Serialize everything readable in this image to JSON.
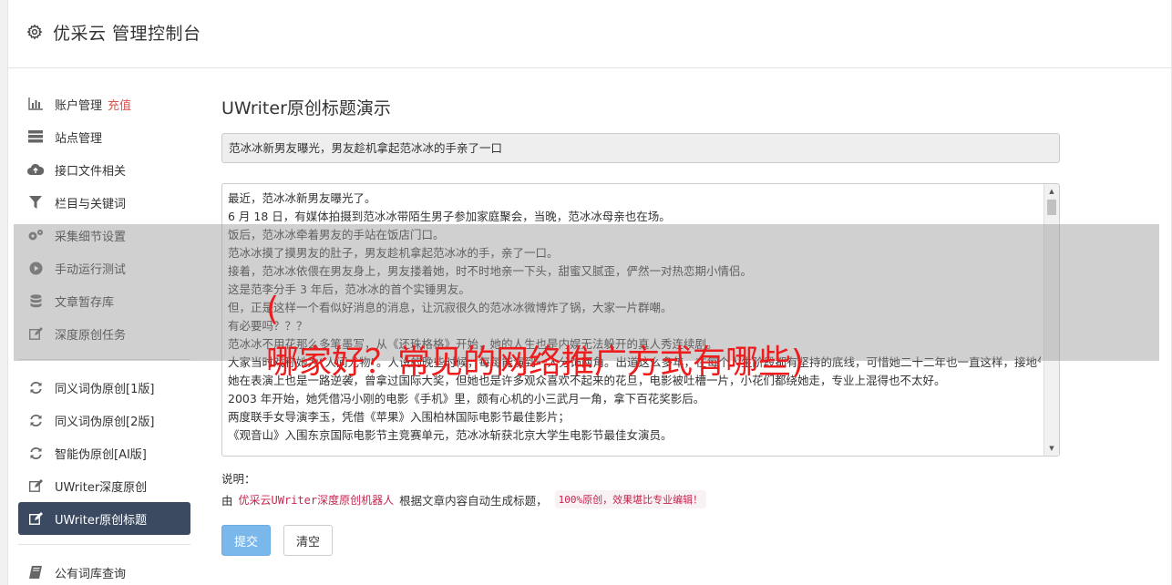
{
  "header": {
    "title": "优采云 管理控制台",
    "icon": "gear-icon"
  },
  "sidebar": {
    "items": [
      {
        "label": "账户管理",
        "badge": "充值",
        "icon": "bar-chart-icon"
      },
      {
        "label": "站点管理",
        "icon": "server-icon"
      },
      {
        "label": "接口文件相关",
        "icon": "cloud-upload-icon"
      },
      {
        "label": "栏目与关键词",
        "icon": "filter-icon"
      },
      {
        "label": "采集细节设置",
        "icon": "cogs-icon"
      },
      {
        "label": "手动运行测试",
        "icon": "play-circle-icon"
      },
      {
        "label": "文章暂存库",
        "icon": "database-icon"
      },
      {
        "label": "深度原创任务",
        "icon": "edit-icon"
      }
    ],
    "items2": [
      {
        "label": "同义词伪原创[1版]",
        "icon": "refresh-icon"
      },
      {
        "label": "同义词伪原创[2版]",
        "icon": "refresh-icon"
      },
      {
        "label": "智能伪原创[AI版]",
        "icon": "refresh-icon"
      },
      {
        "label": "UWriter深度原创",
        "icon": "edit-icon"
      },
      {
        "label": "UWriter原创标题",
        "icon": "edit-icon",
        "active": true
      }
    ],
    "items3": [
      {
        "label": "公有词库查询",
        "icon": "book-icon"
      }
    ]
  },
  "main": {
    "heading": "UWriter原创标题演示",
    "title_value": "范冰冰新男友曝光，男友趁机拿起范冰冰的手亲了一口",
    "article_lines": [
      "最近，范冰冰新男友曝光了。",
      "6 月 18 日，有媒体拍摄到范冰冰带陌生男子参加家庭聚会，当晚，范冰冰母亲也在场。",
      "饭后，范冰冰牵着男友的手站在饭店门口。",
      "范冰冰摸了摸男友的肚子，男友趁机拿起范冰冰的手，亲了一口。",
      "接着，范冰冰依偎在男友身上，男友搂着她，时不时地亲一下头，甜蜜又腻歪，俨然一对热恋期小情侣。",
      "这是范李分手 3 年后，范冰冰的首个实锤男友。",
      "但，正是这样一个看似好消息的消息，让沉寂很久的范冰冰微博炸了锅，大家一片群嘲。",
      "有必要吗？？？",
      "范冰冰不用花那么多笔墨写，从《还珠格格》开始，她的人生也是内娱无法躲开的真人秀连续剧。",
      "大家当时戏称她为“人间尤物”。人设的晚些时候，每每能演到一人分饰两角。出道这么多年，在每个人生阶段都有坚持的底线，可惜她二十二年也一直这样，接地气。",
      "她在表演上也是一路逆袭，曾拿过国际大奖，但她也是许多观众喜欢不起来的花旦，电影被吐槽一片，小花们都绕她走，专业上混得也不太好。",
      "2003 年开始，她凭借冯小刚的电影《手机》里，颇有心机的小三武月一角，拿下百花奖影后。",
      "两度联手女导演李玉，凭借《苹果》入围柏林国际电影节最佳影片；",
      "《观音山》入围东京国际电影节主竞赛单元，范冰冰斩获北京大学生电影节最佳女演员。"
    ],
    "desc_label": "说明：",
    "desc_by": "由",
    "desc_code1": "优采云UWriter深度原创机器人",
    "desc_mid": "根据文章内容自动生成标题，",
    "desc_code2": "100%原创，效果堪比专业编辑！",
    "submit_label": "提交",
    "clear_label": "清空"
  },
  "watermark": {
    "open_paren": "(",
    "text": "哪家好？常见的网络推广方式有哪些)"
  },
  "colors": {
    "active_bg": "#3b4a60",
    "charge": "#d9534f",
    "watermark": "#ee1c1c",
    "submit": "#7ab8ec"
  }
}
